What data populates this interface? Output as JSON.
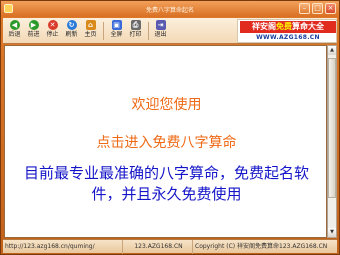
{
  "window": {
    "title": "免费八字算命起名"
  },
  "toolbar": {
    "items": [
      {
        "label": "后退",
        "icon": "back-arrow-icon",
        "color": "#2a9a2a",
        "glyph": "◀"
      },
      {
        "label": "前进",
        "icon": "forward-arrow-icon",
        "color": "#2a9a2a",
        "glyph": "▶"
      },
      {
        "label": "停止",
        "icon": "stop-icon",
        "color": "#d93a2a",
        "glyph": "✕"
      },
      {
        "label": "刷新",
        "icon": "refresh-icon",
        "color": "#2a7ad9",
        "glyph": "↻"
      },
      {
        "label": "主页",
        "icon": "home-icon",
        "color": "#d98a1a",
        "glyph": "⌂"
      },
      {
        "label": "全屏",
        "icon": "fullscreen-icon",
        "color": "#3a6ad9",
        "glyph": "▣"
      },
      {
        "label": "打印",
        "icon": "printer-icon",
        "color": "#6a6a6a",
        "glyph": "⎙"
      },
      {
        "label": "退出",
        "icon": "exit-icon",
        "color": "#5a5ab0",
        "glyph": "⇥"
      }
    ]
  },
  "banner": {
    "title_pre": "祥安阁",
    "title_highlight": "免费",
    "title_post": "算命大全",
    "url": "WWW.AZG168.CN",
    "title_bg": "#e12b1f",
    "highlight_color": "#fff200"
  },
  "content": {
    "welcome": "欢迎您使用",
    "enter_link": "点击进入免费八字算命",
    "description": "目前最专业最准确的八字算命，免费起名软件，并且永久免费使用",
    "accent_color": "#ef6a16",
    "desc_color": "#1414c8"
  },
  "statusbar": {
    "url": "http://123.azg168.cn/quming/",
    "site": "123.AZG168.CN",
    "copyright": "Copyright (C) 祥安阁免费算命123.AZG168.CN"
  }
}
